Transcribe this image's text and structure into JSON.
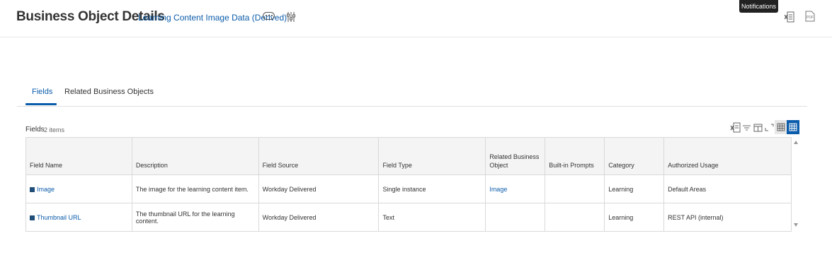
{
  "header": {
    "title": "Business Object Details",
    "object_link": "Learning Content Image Data (Derived)",
    "more_icon": "ellipsis-icon",
    "related_icon": "sliders-icon"
  },
  "tooltip": {
    "text": "Notifications"
  },
  "export": {
    "excel_icon": "excel-icon",
    "pdf_icon": "pdf-icon",
    "pdf_label": "PDF"
  },
  "tabs": [
    {
      "label": "Fields",
      "active": true
    },
    {
      "label": "Related Business Objects",
      "active": false
    }
  ],
  "fields_section": {
    "label": "Fields",
    "count": "2 items"
  },
  "table_toolbar": {
    "icons": [
      "excel-export-icon",
      "filter-icon",
      "columns-icon",
      "fullscreen-icon",
      "grid-view-icon",
      "table-view-icon"
    ]
  },
  "table": {
    "columns": [
      "Field Name",
      "Description",
      "Field Source",
      "Field Type",
      "Related Business Object",
      "Built-in Prompts",
      "Category",
      "Authorized Usage"
    ],
    "rows": [
      {
        "field_name": "Image",
        "description": "The image for the learning content item.",
        "field_source": "Workday Delivered",
        "field_type": "Single instance",
        "related_business_object": "Image",
        "built_in_prompts": "",
        "category": "Learning",
        "authorized_usage": "Default Areas"
      },
      {
        "field_name": "Thumbnail URL",
        "description": "The thumbnail URL for the learning content.",
        "field_source": "Workday Delivered",
        "field_type": "Text",
        "related_business_object": "",
        "built_in_prompts": "",
        "category": "Learning",
        "authorized_usage": "REST API (internal)"
      }
    ]
  },
  "colors": {
    "accent": "#0b5cab",
    "header_bg": "#f4f4f4",
    "border": "#d9d9d9"
  }
}
